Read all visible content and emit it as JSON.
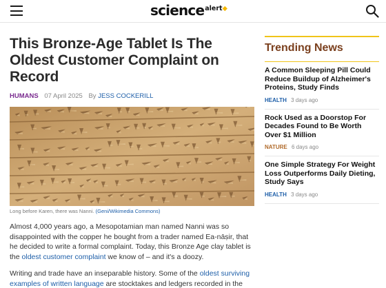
{
  "header": {
    "logo_main": "science",
    "logo_alert": "alert",
    "menu_icon": "hamburger-menu-icon",
    "search_icon": "search-icon"
  },
  "article": {
    "title": "This Bronze-Age Tablet Is The Oldest Customer Complaint on Record",
    "category": "HUMANS",
    "date": "07 April 2025",
    "by": "By",
    "author": "JESS COCKERILL",
    "caption": "Long before Karen, there was Nanni.",
    "credit": "(Geni/Wikimedia Commons)",
    "p1_a": "Almost 4,000 years ago, a Mesopotamian man named Nanni was so disappointed with the copper he bought from a trader named Ea-nāṣir, that he decided to write a formal complaint. Today, this Bronze Age clay tablet is the ",
    "p1_link": "oldest customer complaint",
    "p1_b": " we know of – and it's a doozy.",
    "p2_a": "Writing and trade have an inseparable history. Some of the ",
    "p2_link": "oldest surviving examples of written language",
    "p2_b": " are stocktakes and ledgers recorded in the ancient Mesopotamian cuneiform script."
  },
  "sidebar": {
    "title": "Trending News",
    "items": [
      {
        "headline": "A Common Sleeping Pill Could Reduce Buildup of Alzheimer's Proteins, Study Finds",
        "tag": "HEALTH",
        "ago": "3 days ago"
      },
      {
        "headline": "Rock Used as a Doorstop For Decades Found to Be Worth Over $1 Million",
        "tag": "NATURE",
        "ago": "6 days ago"
      },
      {
        "headline": "One Simple Strategy For Weight Loss Outperforms Daily Dieting, Study Says",
        "tag": "HEALTH",
        "ago": "3 days ago"
      }
    ]
  },
  "colors": {
    "accent_gold": "#f0c419",
    "category_purple": "#7a2b8f",
    "link_blue": "#1d5ea8",
    "trending_title": "#7a3f1d"
  }
}
